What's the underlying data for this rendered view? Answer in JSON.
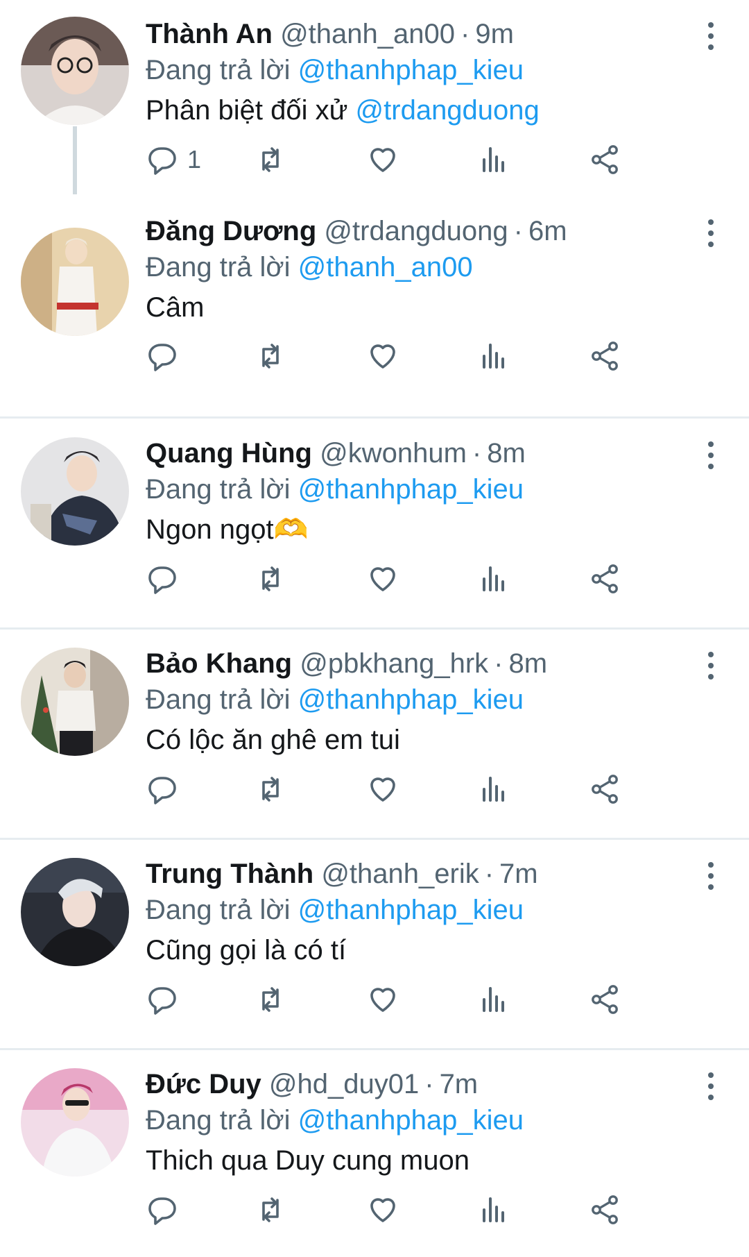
{
  "tweets": [
    {
      "name": "Thành An",
      "handle": "@thanh_an00",
      "time": "9m",
      "reply_prefix": "Đang trả lời",
      "reply_to": "@thanhphap_kieu",
      "text": "Phân biệt đối xử ",
      "text_mention": "@trdangduong",
      "reply_count": "1"
    },
    {
      "name": "Đăng Dương",
      "handle": "@trdangduong",
      "time": "6m",
      "reply_prefix": "Đang trả lời",
      "reply_to": "@thanh_an00",
      "text": "Câm",
      "text_mention": "",
      "reply_count": ""
    },
    {
      "name": "Quang Hùng",
      "handle": "@kwonhum",
      "time": "8m",
      "reply_prefix": "Đang trả lời",
      "reply_to": "@thanhphap_kieu",
      "text": "Ngon ngọt🫶",
      "text_mention": "",
      "reply_count": ""
    },
    {
      "name": "Bảo Khang",
      "handle": "@pbkhang_hrk",
      "time": "8m",
      "reply_prefix": "Đang trả lời",
      "reply_to": "@thanhphap_kieu",
      "text": "Có lộc ăn ghê em tui",
      "text_mention": "",
      "reply_count": ""
    },
    {
      "name": "Trung Thành",
      "handle": "@thanh_erik",
      "time": "7m",
      "reply_prefix": "Đang trả lời",
      "reply_to": "@thanhphap_kieu",
      "text": "Cũng gọi là có tí",
      "text_mention": "",
      "reply_count": ""
    },
    {
      "name": "Đức Duy",
      "handle": "@hd_duy01",
      "time": "7m",
      "reply_prefix": "Đang trả lời",
      "reply_to": "@thanhphap_kieu",
      "text": "Thich qua Duy cung muon",
      "text_mention": "",
      "reply_count": ""
    }
  ],
  "separator": "·",
  "icons": {
    "reply": "reply-icon",
    "retweet": "retweet-icon",
    "like": "heart-icon",
    "views": "views-icon",
    "share": "share-icon",
    "more": "more-icon"
  },
  "colors": {
    "mention": "#1d9bf0",
    "secondary": "#536471",
    "text": "#14171a",
    "divider": "#e6ecf0"
  }
}
